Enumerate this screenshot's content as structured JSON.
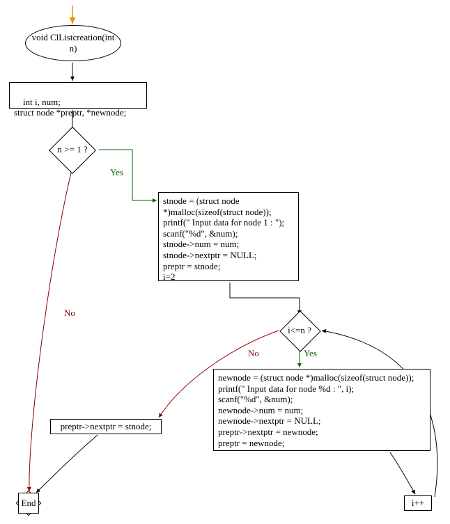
{
  "diagram": {
    "type": "flowchart",
    "start": {
      "label": "void ClListcreation(int n)"
    },
    "declarations": {
      "text": "int i, num;\nstruct node *preptr, *newnode;"
    },
    "decision1": {
      "label": "n >= 1 ?",
      "yes": "Yes",
      "no": "No"
    },
    "block1": {
      "lines": [
        "stnode = (struct node *)malloc(sizeof(struct node));",
        "printf(\" Input data for node 1 : \");",
        "scanf(\"%d\", &num);",
        "stnode->num = num;",
        "stnode->nextptr = NULL;",
        "preptr = stnode;",
        "i=2"
      ]
    },
    "decision2": {
      "label": "i<=n ?",
      "yes": "Yes",
      "no": "No"
    },
    "block2": {
      "lines": [
        "newnode = (struct node *)malloc(sizeof(struct node));",
        "printf(\" Input data for node %d : \", i);",
        "scanf(\"%d\", &num);",
        "newnode->num = num;",
        "newnode->nextptr = NULL;",
        "preptr->nextptr = newnode;",
        "preptr = newnode;"
      ]
    },
    "block3": {
      "text": "preptr->nextptr = stnode;"
    },
    "increment": {
      "text": "i++"
    },
    "end": {
      "label": "End"
    }
  },
  "colors": {
    "yes_edge": "#006400",
    "no_edge": "#8b0000",
    "start_arrow": "#e69500",
    "line": "#000000"
  }
}
